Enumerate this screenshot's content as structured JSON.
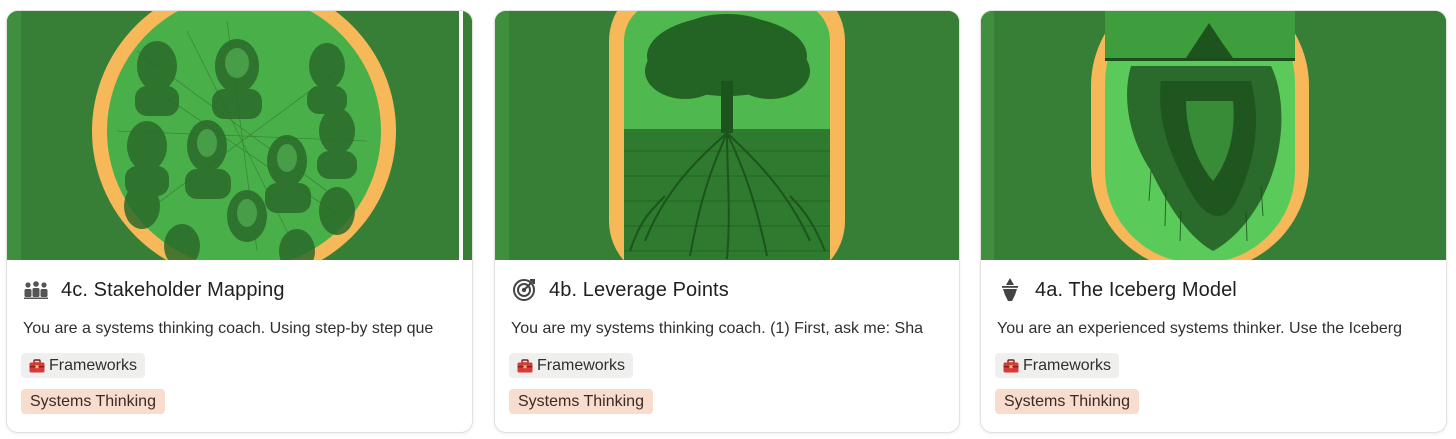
{
  "cards": [
    {
      "title": "4c. Stakeholder Mapping",
      "icon": "people-group-icon",
      "description": "You are a systems thinking coach. Using step-by step que",
      "tool_chip": "Frameworks",
      "tool_icon": "toolbox-icon",
      "tag": "Systems Thinking",
      "cover": "illustrated diverse faces in orange oval on green"
    },
    {
      "title": "4b. Leverage Points",
      "icon": "target-icon",
      "description": "You are my systems thinking coach. (1) First, ask me: Sha",
      "tool_chip": "Frameworks",
      "tool_icon": "toolbox-icon",
      "tag": "Systems Thinking",
      "cover": "illustrated tree with roots in orange frame on green"
    },
    {
      "title": "4a. The Iceberg Model",
      "icon": "iceberg-icon",
      "description": "You are an experienced systems thinker. Use the Iceberg",
      "tool_chip": "Frameworks",
      "tool_icon": "toolbox-icon",
      "tag": "Systems Thinking",
      "cover": "illustrated floating iceberg in orange frame on green"
    }
  ],
  "colors": {
    "cover_green": "#3a8a3a",
    "frame_orange": "#f7b85a",
    "tag_bg": "#f8dccd",
    "chip_bg": "#efefed"
  }
}
